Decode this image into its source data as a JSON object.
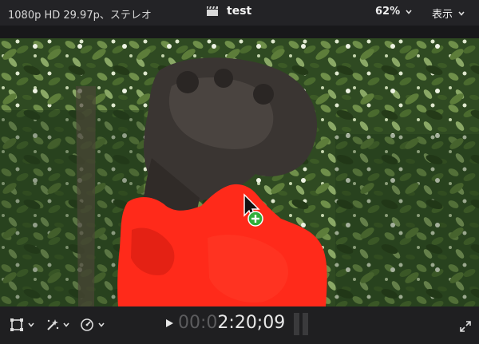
{
  "header": {
    "format_info": "1080p HD 29.97p、ステレオ",
    "project_title": "test",
    "zoom_level": "62%",
    "view_menu": "表示"
  },
  "viewer": {
    "content": "foo-dog-statue-with-red-color-mask-overlay",
    "mask_color": "#ff2a1a"
  },
  "footer": {
    "timecode_dim": "00:0",
    "timecode_bright": "2:20;09"
  },
  "icons": {
    "clapper": "clapperboard-icon",
    "transform": "transform-icon",
    "enhance": "magic-wand-icon",
    "speed": "retime-speedometer-icon",
    "play": "play-icon",
    "fullscreen": "fullscreen-icon",
    "cursor_add": "add-cursor-icon"
  }
}
